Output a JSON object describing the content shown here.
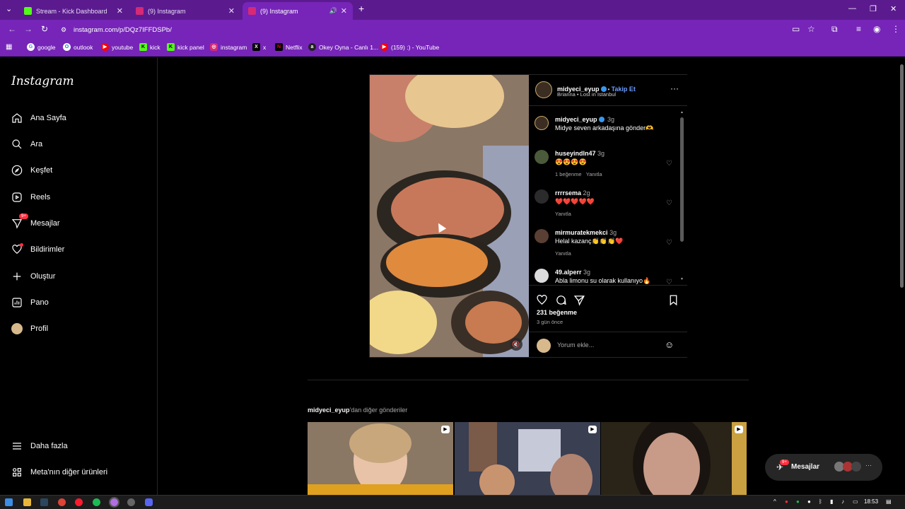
{
  "browser": {
    "tabs": [
      {
        "label": "Stream - Kick Dashboard",
        "color": "#53fc18"
      },
      {
        "label": "(9) Instagram",
        "color": "#d62976"
      },
      {
        "label": "(9) Instagram",
        "color": "#d62976"
      }
    ],
    "url": "instagram.com/p/DQz7IFFDSPb/",
    "bookmarks": [
      {
        "label": "google",
        "color": "#4285f4",
        "icon": "G"
      },
      {
        "label": "outlook",
        "color": "#0078d4",
        "icon": "O"
      },
      {
        "label": "youtube",
        "color": "#ff0000",
        "icon": "▶"
      },
      {
        "label": "kick",
        "color": "#53fc18",
        "icon": "K"
      },
      {
        "label": "kick panel",
        "color": "#53fc18",
        "icon": "K"
      },
      {
        "label": "instagram",
        "color": "#d62976",
        "icon": "◎"
      },
      {
        "label": "x",
        "color": "#000000",
        "icon": "X"
      },
      {
        "label": "Netflix",
        "color": "#e50914",
        "icon": "N"
      },
      {
        "label": "Okey Oyna - Canlı 1...",
        "color": "#222222",
        "icon": "a"
      },
      {
        "label": "(159) :) - YouTube",
        "color": "#ff0000",
        "icon": "▶"
      }
    ]
  },
  "sidebar": {
    "logo": "Instagram",
    "items": [
      {
        "label": "Ana Sayfa",
        "icon": "home-icon"
      },
      {
        "label": "Ara",
        "icon": "search-icon"
      },
      {
        "label": "Keşfet",
        "icon": "compass-icon"
      },
      {
        "label": "Reels",
        "icon": "reels-icon"
      },
      {
        "label": "Mesajlar",
        "icon": "messenger-icon",
        "badge": "9+"
      },
      {
        "label": "Bildirimler",
        "icon": "heart-icon"
      },
      {
        "label": "Oluştur",
        "icon": "plus-icon"
      },
      {
        "label": "Pano",
        "icon": "dashboard-icon"
      },
      {
        "label": "Profil",
        "icon": "avatar"
      }
    ],
    "more": "Daha fazla",
    "meta": "Meta'nın diğer ürünleri"
  },
  "post": {
    "author": "midyeci_eyup",
    "follow": "Takip Et",
    "music": "Brianna • Lost in Istanbul",
    "caption_user": "midyeci_eyup",
    "caption_time": "3g",
    "caption": "Midye seven arkadaşına gönder🫶",
    "comments": [
      {
        "user": "huseyindln47",
        "time": "3g",
        "text": "😍😍😍😍",
        "likes": "1 beğenme",
        "reply": "Yanıtla"
      },
      {
        "user": "rrrrsema",
        "time": "2g",
        "text": "❤️❤️❤️❤️❤️",
        "likes": "",
        "reply": "Yanıtla"
      },
      {
        "user": "mirmuratekmekci",
        "time": "3g",
        "text": "Helal kazanç👏👏👏❤️",
        "likes": "",
        "reply": "Yanıtla"
      },
      {
        "user": "49.alperr",
        "time": "3g",
        "text": "Abla limonu su olarak kullanıyo🔥",
        "likes": "",
        "reply": ""
      }
    ],
    "like_count": "231 beğenme",
    "posted": "3 gün önce",
    "comment_placeholder": "Yorum ekle..."
  },
  "more_posts": {
    "user": "midyeci_eyup",
    "suffix": "'dan diğer gönderiler"
  },
  "messages_pill": {
    "label": "Mesajlar",
    "badge": "9+"
  },
  "taskbar": {
    "time": "18:53"
  }
}
